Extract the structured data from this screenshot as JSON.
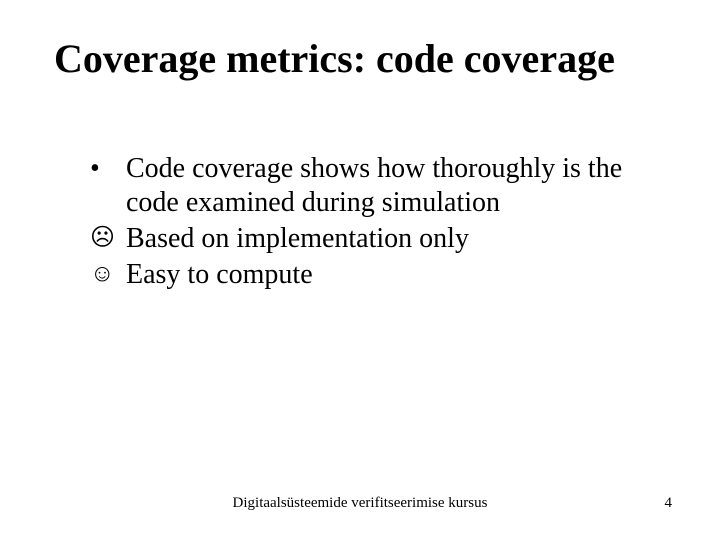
{
  "title": "Coverage metrics: code coverage",
  "bullets": [
    {
      "marker": "•",
      "marker_kind": "dot",
      "text": "Code coverage shows how thoroughly is the code examined during simulation"
    },
    {
      "marker": "☹",
      "marker_kind": "face",
      "text": "Based on implementation only"
    },
    {
      "marker": "☺",
      "marker_kind": "face",
      "text": "Easy to compute"
    }
  ],
  "footer": {
    "center": "Digitaalsüsteemide verifitseerimise kursus",
    "page": "4"
  }
}
